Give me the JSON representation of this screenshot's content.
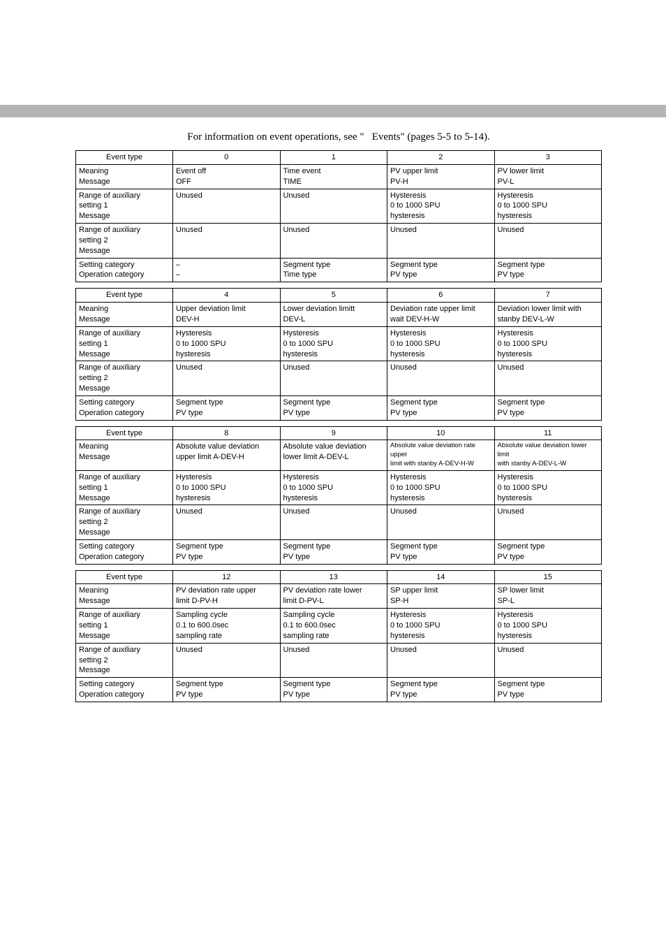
{
  "caption": "For information on event operations, see \"   Events\" (pages 5-5 to 5-14).",
  "row_labels": {
    "event_type": "Event type",
    "meaning": "Meaning\nMessage",
    "aux1": "Range of auxiliary\nsetting 1\nMessage",
    "aux2": "Range of auxiliary\nsetting 2\nMessage",
    "setop": "Setting category\nOperation category"
  },
  "tables": [
    {
      "cols": [
        "0",
        "1",
        "2",
        "3"
      ],
      "rows": {
        "meaning": [
          "Event off\nOFF",
          "Time event\nTIME",
          "PV upper limit\nPV-H",
          "PV lower limit\nPV-L"
        ],
        "aux1": [
          "Unused",
          "Unused",
          "Hysteresis\n0 to 1000 SPU\nhysteresis",
          "Hysteresis\n0 to 1000 SPU\nhysteresis"
        ],
        "aux2": [
          "Unused",
          "Unused",
          "Unused",
          "Unused"
        ],
        "setop": [
          "–\n–",
          "Segment type\nTime type",
          "Segment type\nPV type",
          "Segment type\nPV type"
        ]
      }
    },
    {
      "cols": [
        "4",
        "5",
        "6",
        "7"
      ],
      "rows": {
        "meaning": [
          "Upper deviation limit\nDEV-H",
          "Lower deviation limitt\nDEV-L",
          "Deviation rate upper limit\nwait  DEV-H-W",
          "Deviation lower limit with\nstanby  DEV-L-W"
        ],
        "aux1": [
          "Hysteresis\n0 to 1000 SPU\nhysteresis",
          "Hysteresis\n0 to 1000 SPU\nhysteresis",
          "Hysteresis\n0 to 1000 SPU\nhysteresis",
          "Hysteresis\n0 to 1000 SPU\nhysteresis"
        ],
        "aux2": [
          "Unused",
          "Unused",
          "Unused",
          "Unused"
        ],
        "setop": [
          "Segment type\nPV type",
          "Segment type\nPV type",
          "Segment type\nPV type",
          "Segment type\nPV type"
        ]
      }
    },
    {
      "cols": [
        "8",
        "9",
        "10",
        "11"
      ],
      "meaning_small": [
        false,
        false,
        true,
        true
      ],
      "rows": {
        "meaning": [
          "Absolute value deviation\nupper limit   A-DEV-H",
          "Absolute value deviation\nlower limit   A-DEV-L",
          "Absolute value deviation rate upper\nlimit with stanby   A-DEV-H-W",
          "Absolute value deviation lower limit\nwith stanby   A-DEV-L-W"
        ],
        "aux1": [
          "Hysteresis\n0 to 1000 SPU\nhysteresis",
          "Hysteresis\n0 to 1000 SPU\nhysteresis",
          "Hysteresis\n0 to 1000 SPU\nhysteresis",
          "Hysteresis\n0 to 1000 SPU\nhysteresis"
        ],
        "aux2": [
          "Unused",
          "Unused",
          "Unused",
          "Unused"
        ],
        "setop": [
          "Segment type\nPV type",
          "Segment type\nPV type",
          "Segment type\nPV type",
          "Segment type\nPV type"
        ]
      }
    },
    {
      "cols": [
        "12",
        "13",
        "14",
        "15"
      ],
      "rows": {
        "meaning": [
          "PV deviation rate upper\nlimit   D-PV-H",
          "PV deviation rate lower\nlimit   D-PV-L",
          "SP upper limit\nSP-H",
          "SP lower limit\nSP-L"
        ],
        "aux1": [
          "Sampling cycle\n0.1 to 600.0sec\nsampling rate",
          "Sampling cycle\n0.1 to 600.0sec\nsampling rate",
          "Hysteresis\n0 to 1000 SPU\nhysteresis",
          "Hysteresis\n0 to 1000 SPU\nhysteresis"
        ],
        "aux2": [
          "Unused",
          "Unused",
          "Unused",
          "Unused"
        ],
        "setop": [
          "Segment type\nPV type",
          "Segment type\nPV type",
          "Segment type\nPV type",
          "Segment type\nPV type"
        ]
      }
    }
  ]
}
